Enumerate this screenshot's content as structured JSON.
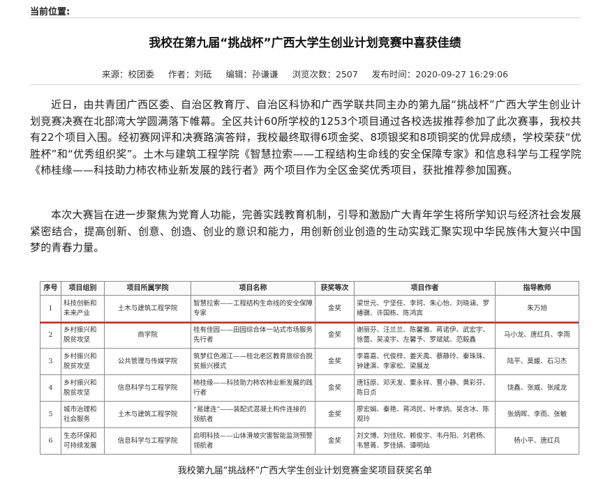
{
  "location_label": "当前位置:",
  "article": {
    "title": "我校在第九届“挑战杯”广西大学生创业计划竞赛中喜获佳绩",
    "meta": {
      "source": "来源：校团委",
      "author": "作者：刘砥",
      "editor": "编辑：孙谦谦",
      "views": "浏览次数：2507",
      "published": "发布时间：2020-09-27 16:29:06"
    },
    "paragraphs": [
      "近日，由共青团广西区委、自治区教育厅、自治区科协和广西学联共同主办的第九届“挑战杯”广西大学生创业计划竞赛决赛在北部湾大学圆满落下帷幕。全区共计60所学校的1253个项目通过各校选拔推荐参加了此次赛事，我校共有22个项目入围。经初赛网评和决赛路演答辩，我校最终取得6项金奖、8项银奖和8项铜奖的优异成绩，学校荣获“优胜杯”和“优秀组织奖”。土木与建筑工程学院《智慧拉索——工程结构生命线的安全保障专家》和信息科学与工程学院《柿桂缘——科技助力柿农柿业新发展的践行者》两个项目作为全区金奖优秀项目，获批推荐参加国赛。",
      "本次大赛旨在进一步聚焦为党育人功能，完善实践教育机制，引导和激励广大青年学生将所学知识与经济社会发展紧密结合，提高创新、创意、创造、创业的意识和能力，用创新创业创造的生动实践汇聚实现中华民族伟大复兴中国梦的青春力量。"
    ]
  },
  "table": {
    "headers": [
      "序号",
      "项目组别",
      "项目所属学院",
      "项目名称",
      "获奖等次",
      "项目作者",
      "指导教师"
    ],
    "rows": [
      [
        "1",
        "科技创新和未来产业",
        "土木与建筑工程学院",
        "智慧拉索——工程结构生命线的安全保障专家",
        "金奖",
        "梁世元、宁坚任、李珂、朱心怡、刘晓涵、罗椿骥、许国栋、陈鸿宾",
        "朱万旭"
      ],
      [
        "2",
        "乡村振兴和脱贫攻坚",
        "商学院",
        "桂有佳园——田园综合体一站式市场服务先行者",
        "金奖",
        "谢丽芬、汪兰兰、陈馨雅、蒋诺伊、武宏宇、徐蕾、吴凌宇、左馨予、罗斌斌、范毅鑫",
        "马小龙、唐红兵、李雨"
      ],
      [
        "3",
        "乡村振兴和脱贫攻坚",
        "公共管理与传媒学院",
        "筑梦红色湘江——桂北老区教育旅综合脱贫振兴模式",
        "金奖",
        "李嘉嘉、代俊梓、姜天禹、蔡静玲、秦珠珠、钟建演、李家松、梁展龙",
        "陆平、莫媛、石习杰"
      ],
      [
        "4",
        "乡村振兴和脱贫攻坚",
        "信息科学与工程学院",
        "柿桂缘——科技助力柿农柿业新发展的践行者",
        "金奖",
        "唐钰原、邓天发、粟永祥、曹小静、黄彩芬、陈日贞",
        "饶鑫、张威、张咸龙"
      ],
      [
        "5",
        "城市治理和社会服务",
        "土木与建筑工程学院",
        "“易建连”——装配式混凝土构件连接的领航者",
        "金奖",
        "廖宏娟、秦艳、蒋鸿民、叶孝炳、吴含冰、陈观玲",
        "张炳晖、李雨、张敏"
      ],
      [
        "6",
        "生态环保和可持续发展",
        "信息科学与工程学院",
        "启明科技——山体滑坡灾害智能监测预警领航者",
        "金奖",
        "刘文博、刘佳欣、赖俊宇、韦丹阳、刘君杨、韦慧菁、罗佳婧、谭明灿",
        "杨小平、唐红兵"
      ]
    ],
    "highlight_row": 1,
    "highlight_color": "#e0241e",
    "caption": "我校第九届“挑战杯”广西大学生创业计划竞赛金奖项目获奖名单"
  }
}
